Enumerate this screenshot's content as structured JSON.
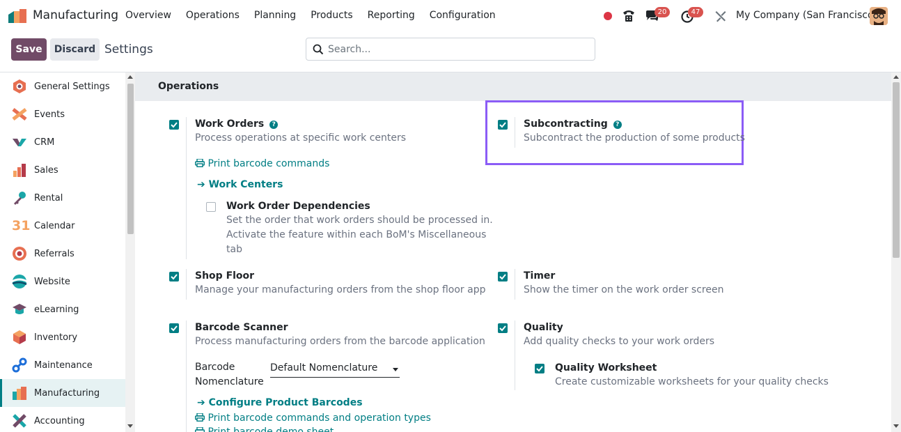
{
  "navbar": {
    "app_name": "Manufacturing",
    "menu": [
      "Overview",
      "Operations",
      "Planning",
      "Products",
      "Reporting",
      "Configuration"
    ],
    "chat_count": "20",
    "activity_count": "47",
    "company": "My Company (San Francisco)"
  },
  "control": {
    "save_label": "Save",
    "discard_label": "Discard",
    "breadcrumb": "Settings",
    "search_placeholder": "Search..."
  },
  "sidebar": {
    "items": [
      {
        "label": "General Settings",
        "icon": "general-settings-icon"
      },
      {
        "label": "Events",
        "icon": "events-icon"
      },
      {
        "label": "CRM",
        "icon": "crm-icon"
      },
      {
        "label": "Sales",
        "icon": "sales-icon"
      },
      {
        "label": "Rental",
        "icon": "rental-icon"
      },
      {
        "label": "Calendar",
        "icon": "calendar-icon"
      },
      {
        "label": "Referrals",
        "icon": "referrals-icon"
      },
      {
        "label": "Website",
        "icon": "website-icon"
      },
      {
        "label": "eLearning",
        "icon": "elearning-icon"
      },
      {
        "label": "Inventory",
        "icon": "inventory-icon"
      },
      {
        "label": "Maintenance",
        "icon": "maintenance-icon"
      },
      {
        "label": "Manufacturing",
        "icon": "manufacturing-icon"
      },
      {
        "label": "Accounting",
        "icon": "accounting-icon"
      }
    ],
    "active": "Manufacturing",
    "calendar_glyph": "31"
  },
  "section": {
    "title": "Operations",
    "work_orders": {
      "title": "Work Orders",
      "desc": "Process operations at specific work centers",
      "checked": true,
      "link_print": "Print barcode commands",
      "link_centers": "Work Centers",
      "dependencies": {
        "title": "Work Order Dependencies",
        "desc_1": "Set the order that work orders should be processed in.",
        "desc_2": "Activate the feature within each BoM's Miscellaneous",
        "desc_3": "tab",
        "checked": false
      }
    },
    "subcontracting": {
      "title": "Subcontracting",
      "desc": "Subcontract the production of some products",
      "checked": true
    },
    "shop_floor": {
      "title": "Shop Floor",
      "desc": "Manage your manufacturing orders from the shop floor app",
      "checked": true
    },
    "timer": {
      "title": "Timer",
      "desc": "Show the timer on the work order screen",
      "checked": true
    },
    "barcode": {
      "title": "Barcode Scanner",
      "desc": "Process manufacturing orders from the barcode application",
      "checked": true,
      "field_label_1": "Barcode",
      "field_label_2": "Nomenclature",
      "field_value": "Default Nomenclature",
      "link_configure": "Configure Product Barcodes",
      "link_print": "Print barcode commands and operation types",
      "link_demo": "Print barcode demo sheet"
    },
    "quality": {
      "title": "Quality",
      "desc": "Add quality checks to your work orders",
      "checked": true,
      "worksheet": {
        "title": "Quality Worksheet",
        "desc": "Create customizable worksheets for your quality checks",
        "checked": true
      }
    }
  },
  "colors": {
    "brand": "#714b67",
    "accent": "#017e84",
    "highlight": "#8b5cf6"
  }
}
